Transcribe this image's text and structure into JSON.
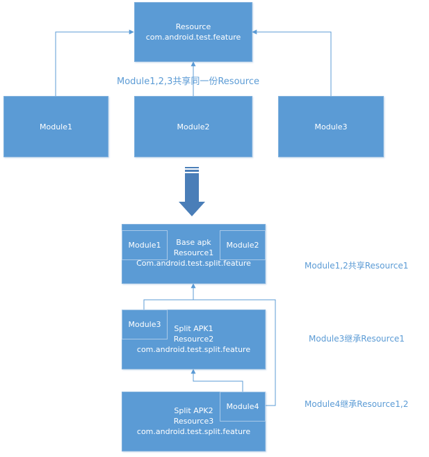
{
  "top_diagram": {
    "resource_box": {
      "line1": "Resource",
      "line2": "com.android.test.feature"
    },
    "modules": [
      {
        "label": "Module1"
      },
      {
        "label": "Module2"
      },
      {
        "label": "Module3"
      }
    ],
    "shared_note": "Module1,2,3共享同一份Resource"
  },
  "transition_arrow": {
    "icon": "down-arrow-icon",
    "color": "#4a7eb8"
  },
  "bottom_diagram": {
    "base_apk": {
      "line1": "Base apk",
      "line2": "Resource1",
      "line3": "Com.android.test.split.feature",
      "inner_modules": [
        "Module1",
        "Module2"
      ]
    },
    "split_apk1": {
      "line1": "Split APK1",
      "line2": "Resource2",
      "line3": "com.android.test.split.feature",
      "inner_module": "Module3"
    },
    "split_apk2": {
      "line1": "Split APK2",
      "line2": "Resource3",
      "line3": "com.android.test.split.feature",
      "inner_module": "Module4"
    },
    "notes": [
      "Module1,2共享Resource1",
      "Module3继承Resource1",
      "Module4继承Resource1,2"
    ]
  },
  "colors": {
    "box_fill": "#5b9bd5",
    "line": "#5b9bd5",
    "text_note": "#5b9bd5"
  }
}
